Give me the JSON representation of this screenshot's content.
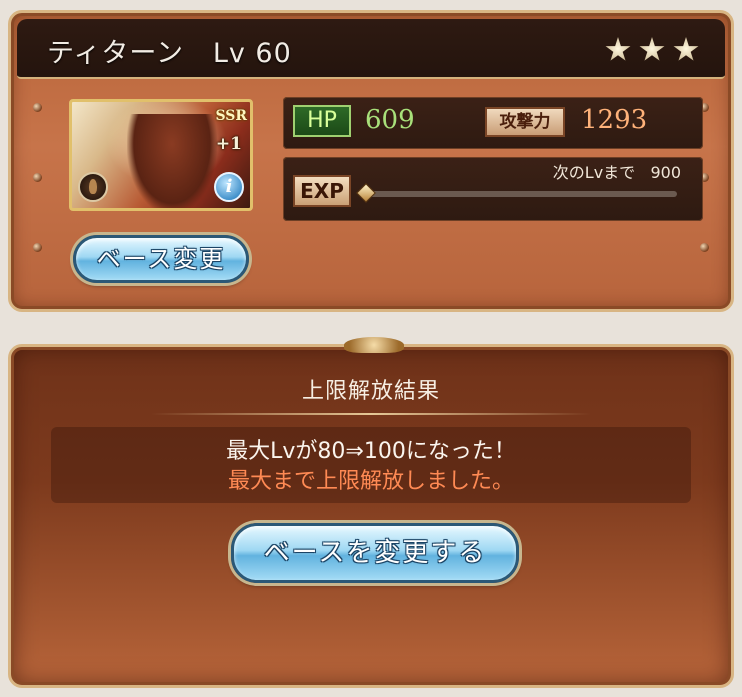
{
  "character": {
    "name": "ティターン",
    "level_text": "Lv 60",
    "rarity": "SSR",
    "plus": "+1",
    "stars_count": 3,
    "info_icon": "i"
  },
  "stats": {
    "hp_label": "HP",
    "hp_value": "609",
    "atk_label": "攻撃力",
    "atk_value": "1293",
    "exp_label": "EXP",
    "next_level_label": "次のLvまで",
    "next_level_value": "900",
    "exp_progress": 0.0
  },
  "buttons": {
    "base_change": "ベース変更",
    "change_base": "ベースを変更する"
  },
  "result": {
    "title": "上限解放結果",
    "line1": "最大Lvが80⇒100になった！",
    "line2": "最大まで上限解放しました。"
  },
  "colors": {
    "hp": "#a8e07a",
    "attack": "#ffb27a",
    "highlight": "#ff8a54"
  }
}
